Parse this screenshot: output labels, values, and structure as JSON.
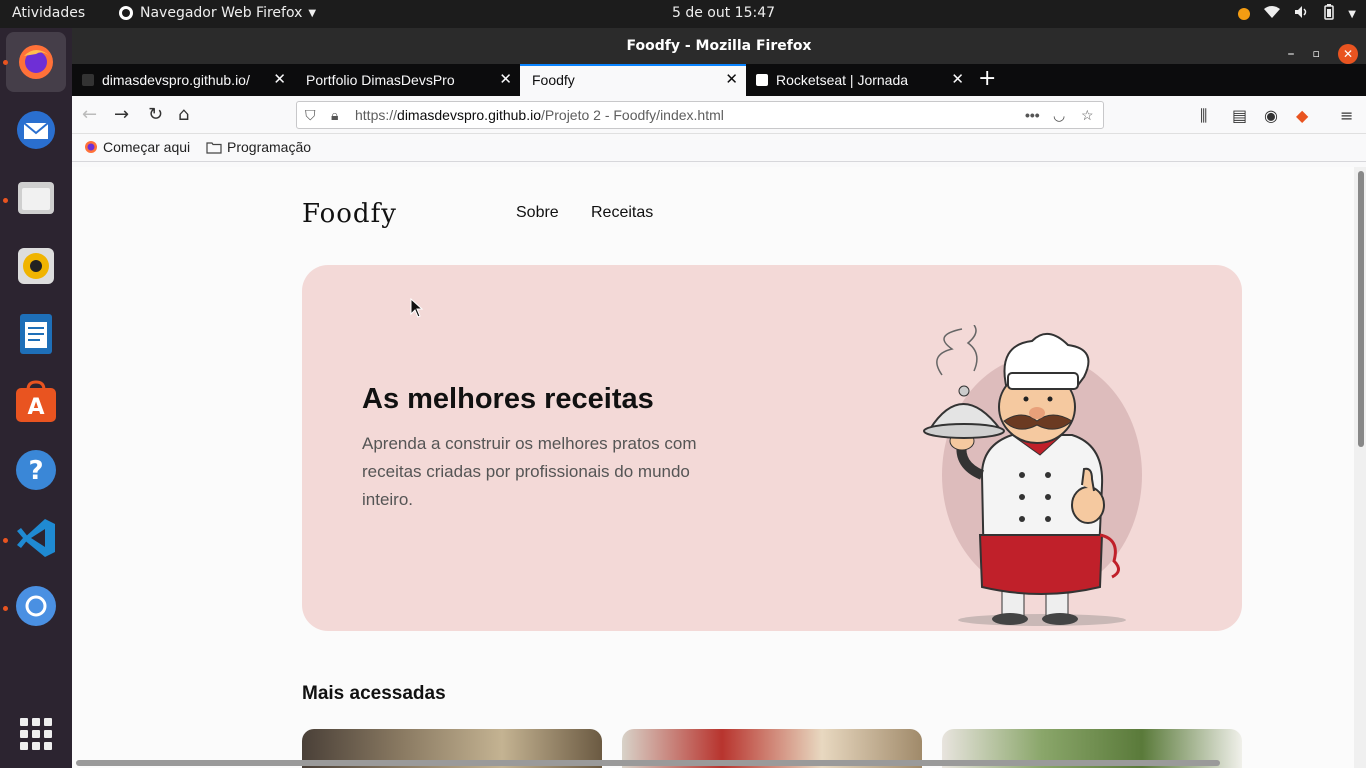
{
  "system": {
    "activities": "Atividades",
    "app_menu": "Navegador Web Firefox",
    "clock": "5 de out  15:47"
  },
  "window": {
    "title": "Foodfy - Mozilla Firefox"
  },
  "tabs": [
    {
      "label": "dimasdevspro.github.io/"
    },
    {
      "label": "Portfolio DimasDevsPro"
    },
    {
      "label": "Foodfy"
    },
    {
      "label": "Rocketseat | Jornada"
    }
  ],
  "url": {
    "prefix": "https://",
    "domain": "dimasdevspro.github.io",
    "path": "/Projeto 2 - Foodfy/index.html"
  },
  "bookmarks": [
    {
      "label": "Começar aqui"
    },
    {
      "label": "Programação"
    }
  ],
  "page": {
    "logo": "Foodfy",
    "nav": [
      "Sobre",
      "Receitas"
    ],
    "hero_title": "As melhores receitas",
    "hero_text": "Aprenda a construir os melhores pratos com receitas criadas por profissionais do mundo inteiro.",
    "section_title": "Mais acessadas"
  },
  "colors": {
    "hero_bg": "#f3d9d7",
    "ubuntu_orange": "#e95420",
    "firefox_blue": "#0a84ff"
  }
}
